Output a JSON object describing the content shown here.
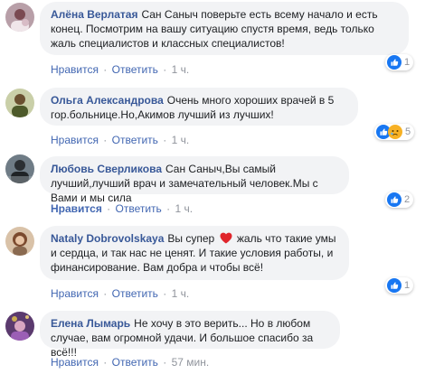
{
  "actions": {
    "like": "Нравится",
    "reply": "Ответить",
    "dot": "·"
  },
  "colors": {
    "author": "#385898",
    "link": "#4267b2",
    "bubble": "#f2f3f5",
    "meta": "#90949c"
  },
  "comments": [
    {
      "author": "Алёна Верлатая",
      "text": "Сан Саныч поверьте есть всему начало и есть конец. Посмотрим на вашу ситуацию спустя время, ведь только жаль специалистов и классных специалистов!",
      "time": "1 ч.",
      "liked": false,
      "reaction_count": "1",
      "reaction_icons": [
        "like-icon"
      ]
    },
    {
      "author": "Ольга Александрова",
      "text": "Очень много хороших врачей в 5 гор.больнице.Но,Акимов лучший из лучших!",
      "time": "1 ч.",
      "liked": false,
      "reaction_count": "5",
      "reaction_icons": [
        "like-icon",
        "sad-icon"
      ]
    },
    {
      "author": "Любовь Сверликова",
      "text": "Сан Саныч,Вы самый лучший,лучший врач и замечательный человек.Мы с Вами и мы сила",
      "time": "1 ч.",
      "liked": true,
      "reaction_count": "2",
      "reaction_icons": [
        "like-icon"
      ]
    },
    {
      "author": "Nataly Dobrovolskaya",
      "text_before": "Вы супер",
      "text_after": "жаль что такие умы и сердца, и так нас не ценят. И такие условия работы, и финансирование. Вам добра и чтобы всё!",
      "time": "1 ч.",
      "liked": false,
      "reaction_count": "1",
      "reaction_icons": [
        "like-icon"
      ]
    },
    {
      "author": "Елена Лымарь",
      "text": "Не хочу в это верить... Но в любом случае, вам огромной удачи. И большое спасибо за всё!!!",
      "time": "57 мин.",
      "liked": false
    }
  ]
}
